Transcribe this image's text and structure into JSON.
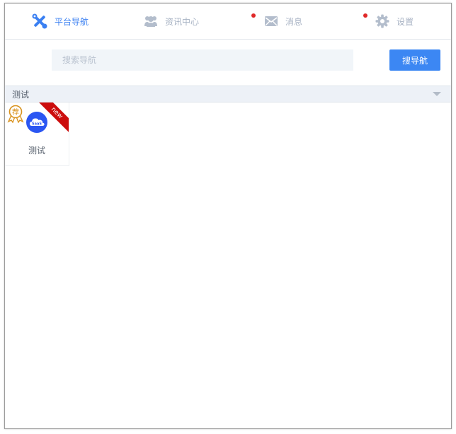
{
  "nav": {
    "items": [
      {
        "label": "平台导航",
        "icon": "tools-icon",
        "active": true
      },
      {
        "label": "资讯中心",
        "icon": "users-icon",
        "active": false
      },
      {
        "label": "消息",
        "icon": "mail-icon",
        "active": false,
        "has_dot": true
      },
      {
        "label": "设置",
        "icon": "gear-icon",
        "active": false,
        "has_dot": true
      }
    ]
  },
  "search": {
    "placeholder": "搜索导航",
    "button_label": "搜导航"
  },
  "category": {
    "title": "测试",
    "items": [
      {
        "label": "测试",
        "logo_text": "SaaS",
        "ribbon": "new",
        "badge": "荐"
      }
    ]
  },
  "colors": {
    "accent": "#3c87f3",
    "nav_inactive": "#a8b3c4",
    "dot": "#e02828",
    "ribbon": "#cc0d0d",
    "badge": "#d9931f",
    "logo_bg": "#2b56f2"
  }
}
